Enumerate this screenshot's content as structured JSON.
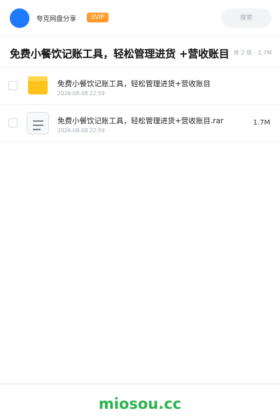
{
  "header": {
    "user_name": "夸克网盘分享",
    "badge": "SVIP",
    "search_placeholder": "搜索"
  },
  "share": {
    "title": "免费小餐饮记账工具，轻松管理进货 +营收账目",
    "count_text": "共 2 项",
    "separator": "·",
    "total_size": "1.7M"
  },
  "files": [
    {
      "name": "免费小餐饮记账工具，轻松管理进货+营收账目",
      "date": "2026-08-08 22:59",
      "size": "",
      "icon": "folder-icon"
    },
    {
      "name": "免费小餐饮记账工具，轻松管理进货+营收账目.rar",
      "date": "2026-08-08 22:59",
      "size": "1.7M",
      "icon": "document-icon"
    }
  ],
  "footer": {
    "watermark": "miosou.cc"
  },
  "colors": {
    "accent": "#1e7bff",
    "badge": "#ff9b2c",
    "folder": "#ffc21a",
    "watermark": "#2bb24c"
  }
}
